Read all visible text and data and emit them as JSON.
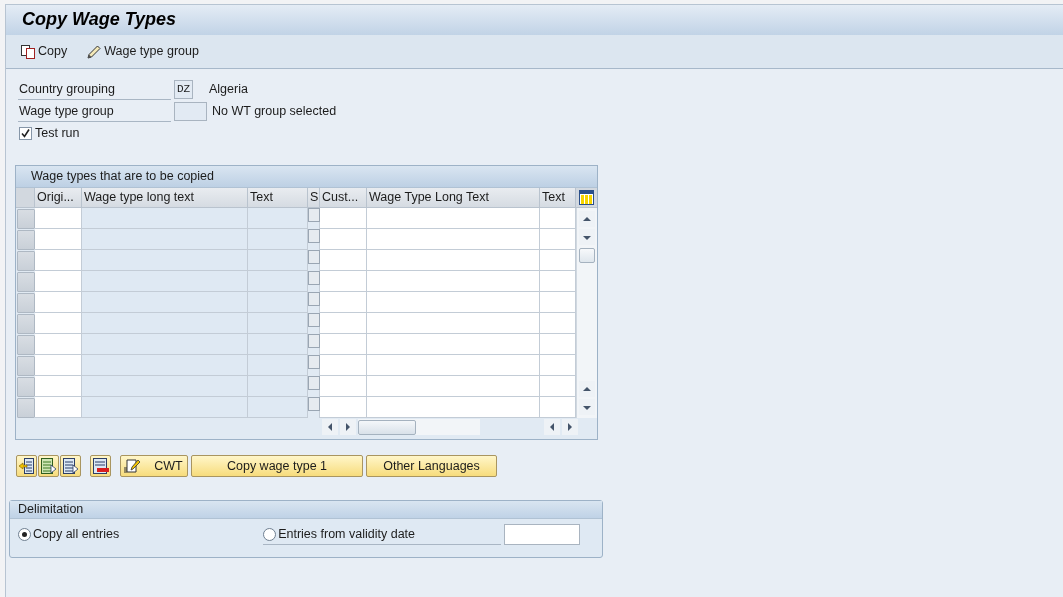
{
  "window": {
    "title": "Copy Wage Types"
  },
  "toolbar": [
    {
      "label": "Copy"
    },
    {
      "label": "Wage type group"
    }
  ],
  "selection": {
    "country_grouping": {
      "label": "Country grouping",
      "value": "DZ",
      "description": "Algeria"
    },
    "wage_type_group": {
      "label": "Wage type group",
      "description": "No WT group selected"
    },
    "test_run": {
      "label": "Test run",
      "checked": true
    }
  },
  "table": {
    "title": "Wage types that are to be copied",
    "columns": [
      {
        "label": "Origi...",
        "kind": "input"
      },
      {
        "label": "Wage type long text",
        "kind": "display"
      },
      {
        "label": "Text",
        "kind": "display"
      },
      {
        "label": "S",
        "kind": "checkbox"
      },
      {
        "label": "Cust...",
        "kind": "input"
      },
      {
        "label": "Wage Type Long Text",
        "kind": "input"
      },
      {
        "label": "Text",
        "kind": "input"
      }
    ],
    "rows": [
      {
        "selected": false,
        "checked": false
      },
      {
        "selected": false,
        "checked": false
      },
      {
        "selected": false,
        "checked": false
      },
      {
        "selected": false,
        "checked": false
      },
      {
        "selected": false,
        "checked": false
      },
      {
        "selected": false,
        "checked": false
      },
      {
        "selected": false,
        "checked": false
      },
      {
        "selected": false,
        "checked": false
      },
      {
        "selected": false,
        "checked": false
      },
      {
        "selected": false,
        "checked": false
      }
    ]
  },
  "buttons": [
    {
      "label": "CWT",
      "kind": "icon-text"
    },
    {
      "label": "Copy wage type 1",
      "kind": "text"
    },
    {
      "label": "Other Languages",
      "kind": "text"
    }
  ],
  "delimitation": {
    "title": "Delimitation",
    "options": [
      {
        "label": "Copy all entries",
        "selected": true
      },
      {
        "label": "Entries from validity date",
        "selected": false
      }
    ]
  }
}
